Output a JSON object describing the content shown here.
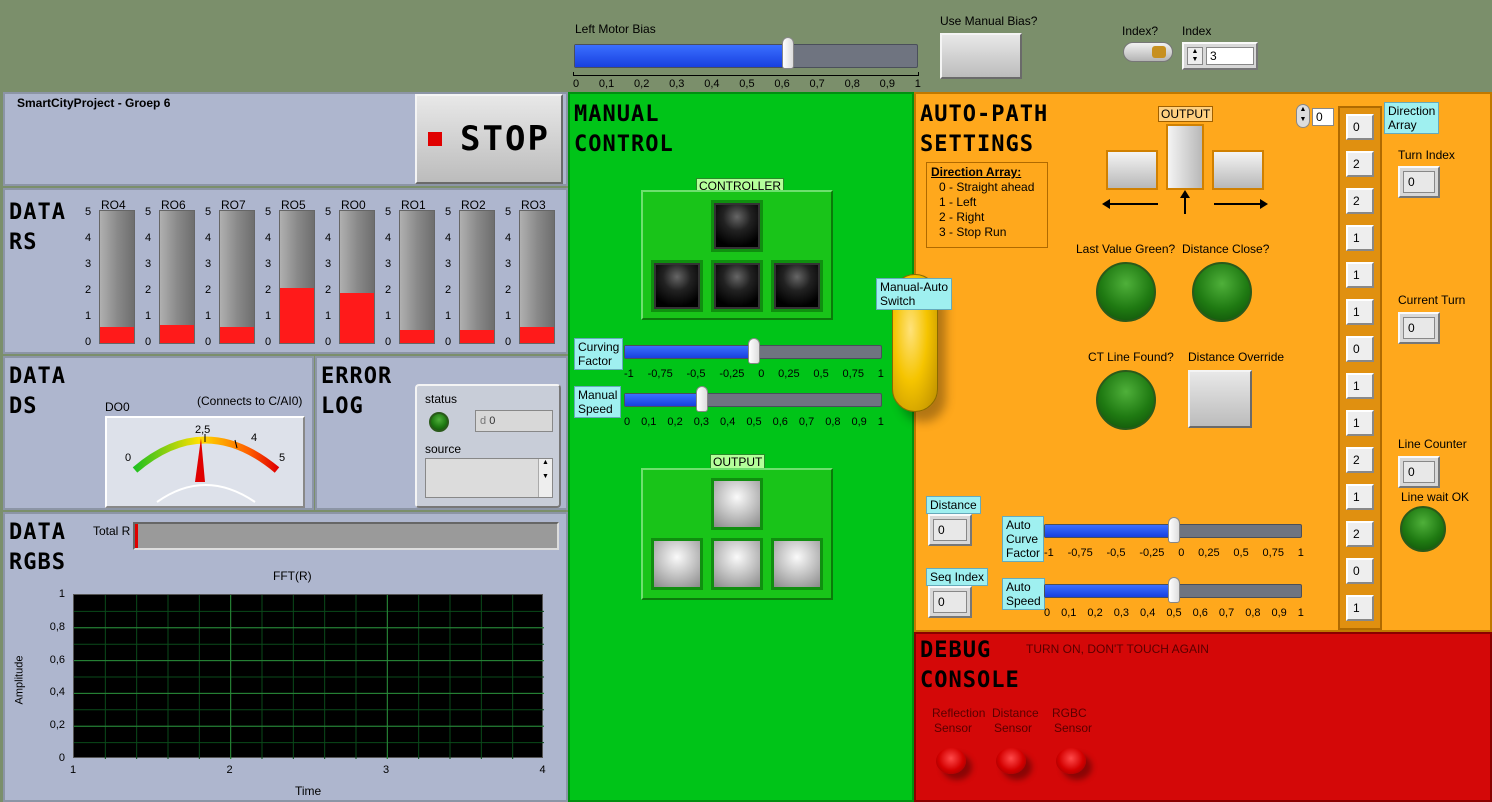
{
  "top": {
    "left_motor_bias": {
      "label": "Left Motor Bias",
      "value": 0.62,
      "ticks": [
        "0",
        "0,1",
        "0,2",
        "0,3",
        "0,4",
        "0,5",
        "0,6",
        "0,7",
        "0,8",
        "0,9",
        "1"
      ]
    },
    "use_manual_bias": {
      "label": "Use Manual Bias?"
    },
    "index_toggle": {
      "label": "Index?"
    },
    "index": {
      "label": "Index",
      "value": "3"
    }
  },
  "header": {
    "title": "SmartCityProject - Groep 6",
    "stop_label": "STOP"
  },
  "datars": {
    "title1": "DATA",
    "title2": "RS",
    "scale": [
      "5",
      "4",
      "3",
      "2",
      "1",
      "0"
    ],
    "tanks": [
      {
        "name": "RO4",
        "value": 0.12
      },
      {
        "name": "RO6",
        "value": 0.14
      },
      {
        "name": "RO7",
        "value": 0.12
      },
      {
        "name": "RO5",
        "value": 0.42
      },
      {
        "name": "RO0",
        "value": 0.38
      },
      {
        "name": "RO1",
        "value": 0.1
      },
      {
        "name": "RO2",
        "value": 0.1
      },
      {
        "name": "RO3",
        "value": 0.12
      }
    ]
  },
  "datads": {
    "title1": "DATA",
    "title2": "DS",
    "gauge_label": "DO0",
    "note": "(Connects to C/AI0)",
    "ticks": [
      "0",
      "2,5",
      "4",
      "5"
    ]
  },
  "errorlog": {
    "title1": "ERROR",
    "title2": "LOG",
    "status_label": "status",
    "code_value": "0",
    "code_prefix": "d",
    "source_label": "source"
  },
  "datargbs": {
    "title1": "DATA",
    "title2": "RGBS",
    "total_r_label": "Total R",
    "fft": {
      "title": "FFT(R)",
      "ylabel": "Amplitude",
      "xlabel": "Time",
      "yticks": [
        "1",
        "0,8",
        "0,6",
        "0,4",
        "0,2",
        "0"
      ],
      "xticks": [
        "1",
        "2",
        "3",
        "4"
      ]
    }
  },
  "manual": {
    "title1": "MANUAL",
    "title2": "CONTROL",
    "controller_label": "CONTROLLER",
    "output_label": "OUTPUT",
    "curving": {
      "label1": "Curving",
      "label2": "Factor",
      "value": 0,
      "ticks": [
        "-1",
        "-0,75",
        "-0,5",
        "-0,25",
        "0",
        "0,25",
        "0,5",
        "0,75",
        "1"
      ]
    },
    "speed": {
      "label1": "Manual",
      "label2": "Speed",
      "value": 0.3,
      "ticks": [
        "0",
        "0,1",
        "0,2",
        "0,3",
        "0,4",
        "0,5",
        "0,6",
        "0,7",
        "0,8",
        "0,9",
        "1"
      ]
    },
    "switch": {
      "label1": "Manual-Auto",
      "label2": "Switch"
    }
  },
  "auto": {
    "title1": "AUTO-PATH",
    "title2": "SETTINGS",
    "output_label": "OUTPUT",
    "direction_title": "Direction Array:",
    "direction_items": [
      "0 - Straight ahead",
      "1 - Left",
      "2 - Right",
      "3 - Stop Run"
    ],
    "last_value_green": "Last Value Green?",
    "distance_close": "Distance Close?",
    "ct_line_found": "CT Line Found?",
    "distance_override": "Distance Override",
    "distance": {
      "label": "Distance",
      "value": "0"
    },
    "seq_index": {
      "label": "Seq Index",
      "value": "0"
    },
    "auto_curve": {
      "label1": "Auto",
      "label2": "Curve",
      "label3": "Factor",
      "value": 0,
      "ticks": [
        "-1",
        "-0,75",
        "-0,5",
        "-0,25",
        "0",
        "0,25",
        "0,5",
        "0,75",
        "1"
      ]
    },
    "auto_speed": {
      "label1": "Auto",
      "label2": "Speed",
      "value": 0.5,
      "ticks": [
        "0",
        "0,1",
        "0,2",
        "0,3",
        "0,4",
        "0,5",
        "0,6",
        "0,7",
        "0,8",
        "0,9",
        "1"
      ]
    },
    "array_index": "0",
    "direction_array_label1": "Direction",
    "direction_array_label2": "Array",
    "direction_values": [
      "0",
      "2",
      "2",
      "1",
      "1",
      "1",
      "0",
      "1",
      "1",
      "2",
      "1",
      "2",
      "0",
      "1"
    ],
    "turn_index": {
      "label": "Turn Index",
      "value": "0"
    },
    "current_turn": {
      "label": "Current Turn",
      "value": "0"
    },
    "line_counter": {
      "label": "Line Counter",
      "value": "0"
    },
    "line_wait_ok": "Line wait OK"
  },
  "debug": {
    "title1": "DEBUG",
    "title2": "CONSOLE",
    "note": "TURN ON, DON'T TOUCH AGAIN",
    "sensors": [
      {
        "l1": "Reflection",
        "l2": "Sensor"
      },
      {
        "l1": "Distance",
        "l2": "Sensor"
      },
      {
        "l1": "RGBC",
        "l2": "Sensor"
      }
    ]
  },
  "colors": {
    "manual_bg": "#00c418",
    "auto_bg": "#ffa81c",
    "debug_bg": "#d40808",
    "panel_bg": "#aeb6ce",
    "desktop_bg": "#7b8f6b"
  }
}
